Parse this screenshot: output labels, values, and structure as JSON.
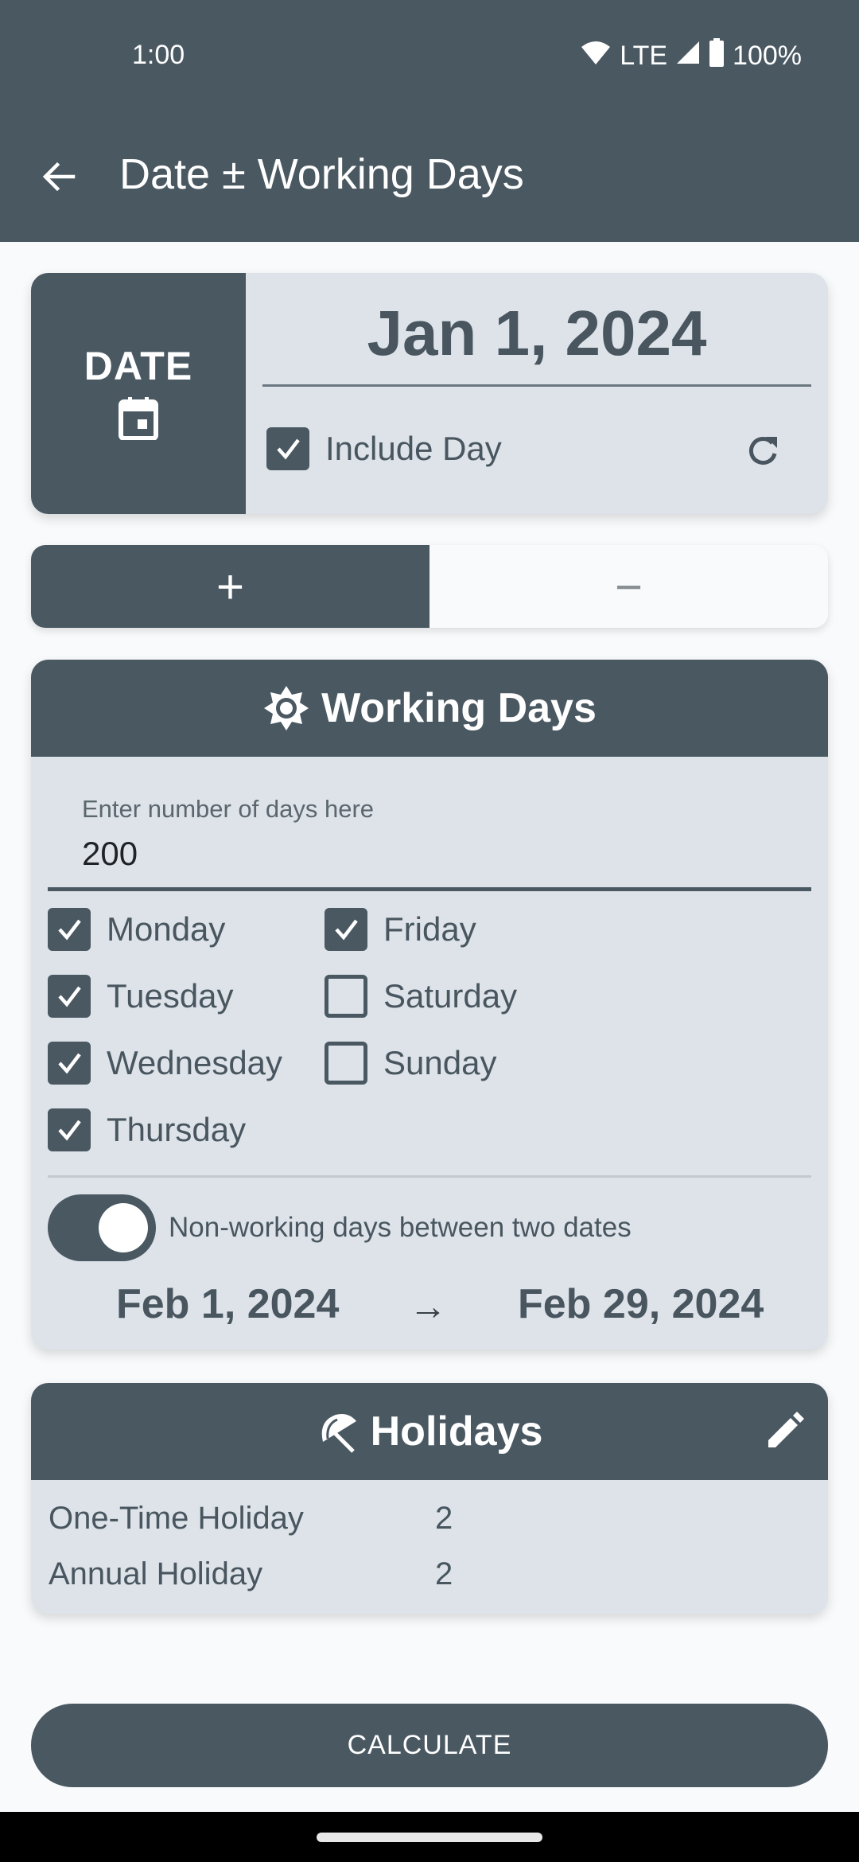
{
  "status_bar": {
    "time": "1:00",
    "network": "LTE",
    "battery": "100%",
    "icons": [
      "wifi-icon",
      "signal-icon",
      "battery-icon"
    ]
  },
  "app_bar": {
    "title": "Date ± Working Days",
    "back_icon": "arrow-back-icon"
  },
  "date_card": {
    "label": "DATE",
    "icon": "calendar-icon",
    "value": "Jan 1, 2024",
    "include_day": {
      "label": "Include Day",
      "checked": true
    },
    "reset_icon": "refresh-icon"
  },
  "operation": {
    "plus_label": "+",
    "minus_label": "−",
    "selected": "plus"
  },
  "working_days": {
    "title": "Working Days",
    "icon": "brightness-icon",
    "input": {
      "label": "Enter number of days here",
      "value": "200"
    },
    "days": [
      {
        "label": "Monday",
        "checked": true
      },
      {
        "label": "Tuesday",
        "checked": true
      },
      {
        "label": "Wednesday",
        "checked": true
      },
      {
        "label": "Thursday",
        "checked": true
      },
      {
        "label": "Friday",
        "checked": true
      },
      {
        "label": "Saturday",
        "checked": false
      },
      {
        "label": "Sunday",
        "checked": false
      }
    ],
    "non_working_switch": {
      "label": "Non-working days between two dates",
      "on": true
    },
    "range": {
      "from": "Feb 1, 2024",
      "arrow": "→",
      "to": "Feb 29, 2024"
    }
  },
  "holidays": {
    "title": "Holidays",
    "icon": "beach-umbrella-icon",
    "edit_icon": "pencil-icon",
    "rows": [
      {
        "label": "One-Time Holiday",
        "value": "2"
      },
      {
        "label": "Annual Holiday",
        "value": "2"
      }
    ]
  },
  "calculate_label": "CALCULATE",
  "colors": {
    "primary": "#4a5862",
    "card_bg": "#dde3e9",
    "page_bg": "#f8fafc"
  }
}
